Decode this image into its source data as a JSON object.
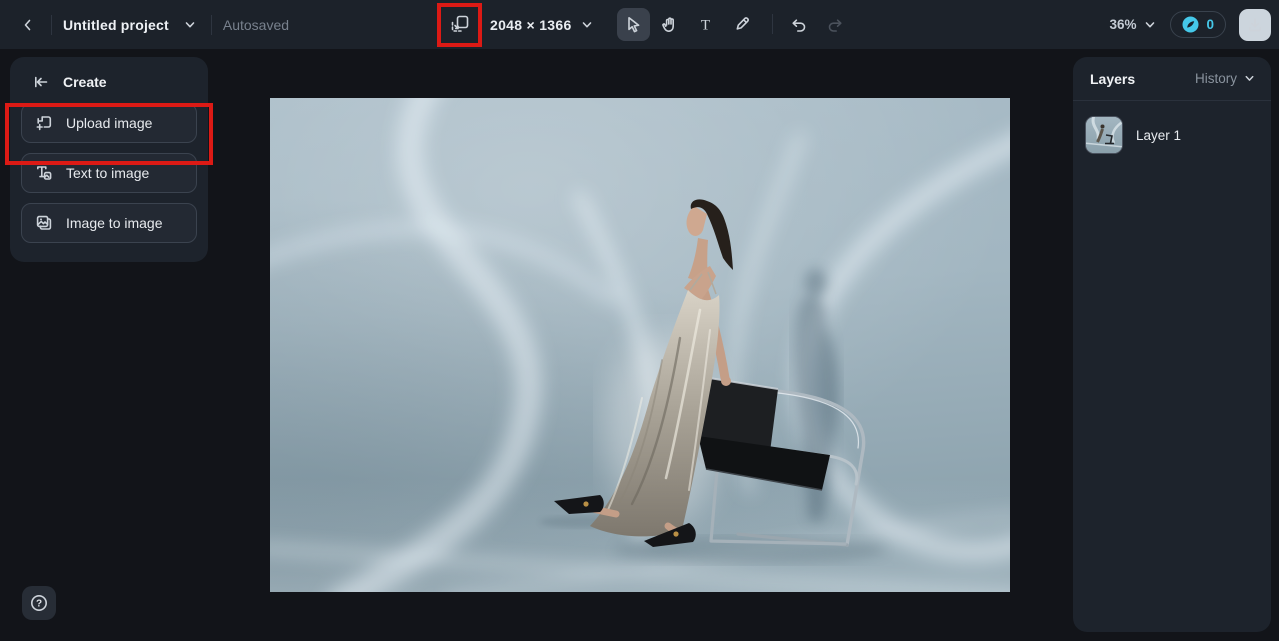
{
  "colors": {
    "annotation_red": "#dc1a15",
    "accent_cyan": "#45c8e9",
    "download_button_bg": "#ccd5dd",
    "panel_bg": "#1d232c",
    "topbar_bg": "#1c222a",
    "workspace_bg": "#121419"
  },
  "topbar": {
    "back_icon": "chevron-left",
    "project_title": "Untitled project",
    "autosave_status": "Autosaved",
    "resize_icon": "resize-canvas",
    "canvas_size": "2048 × 1366",
    "tools": [
      {
        "name": "select",
        "icon": "cursor-arrow",
        "active": true
      },
      {
        "name": "hand",
        "icon": "hand",
        "active": false
      },
      {
        "name": "text",
        "icon": "letter-T",
        "active": false
      },
      {
        "name": "brush",
        "icon": "brush-pen",
        "active": false
      },
      {
        "name": "undo",
        "icon": "undo-arrow",
        "active": false
      },
      {
        "name": "redo",
        "icon": "redo-arrow",
        "disabled": true
      }
    ],
    "text_tool_glyph": "T",
    "zoom_level": "36%",
    "credits_count": "0",
    "download_icon": "download"
  },
  "left_panel": {
    "header": "Create",
    "back_icon": "arrow-left-to-bar",
    "buttons": [
      {
        "label": "Upload image",
        "icon": "image-plus",
        "annotated": true
      },
      {
        "label": "Text to image",
        "icon": "text-to-image",
        "annotated": false
      },
      {
        "label": "Image to image",
        "icon": "image-to-image",
        "annotated": false
      }
    ]
  },
  "right_panel": {
    "layers_tab": "Layers",
    "history_tab": "History",
    "layers": [
      {
        "name": "Layer 1"
      }
    ]
  },
  "canvas": {
    "description": "Fashion photo: woman in silver metallic slip dress leaning on a black chrome-frame chair, blue-grey studio backdrop with swirling light streaks"
  },
  "help": {
    "glyph": "?"
  }
}
